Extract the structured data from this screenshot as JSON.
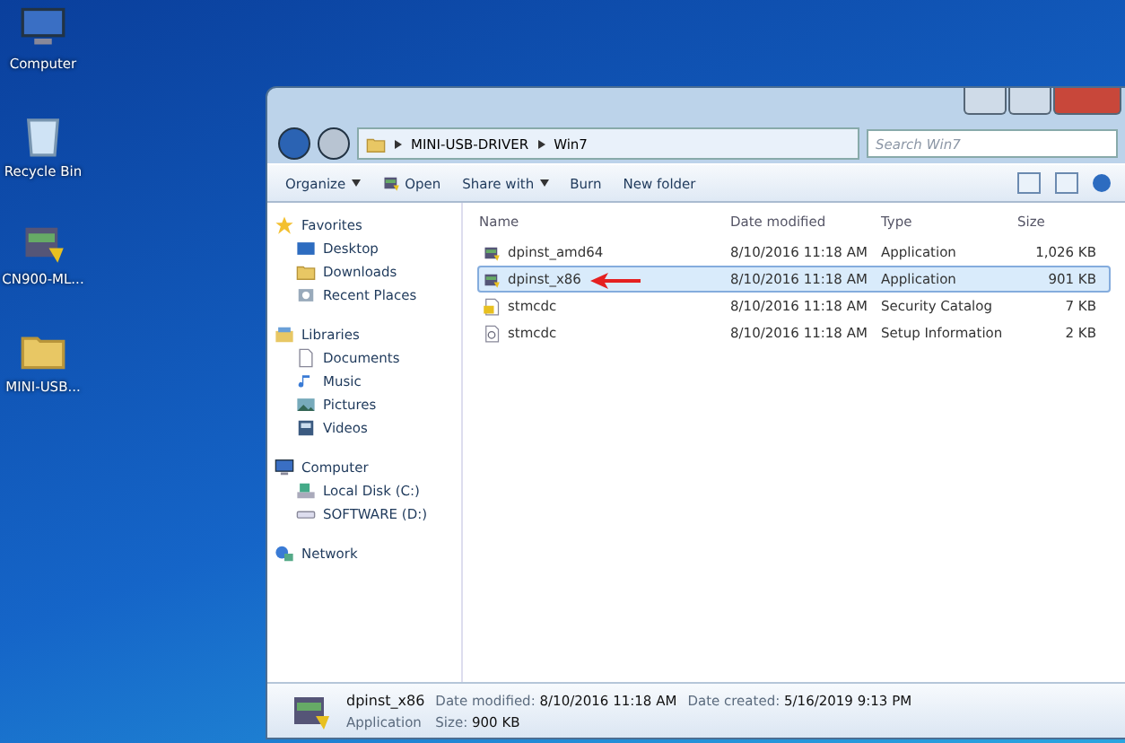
{
  "desktop_icons": [
    {
      "label": "Computer",
      "kind": "computer"
    },
    {
      "label": "Recycle Bin",
      "kind": "recycle"
    },
    {
      "label": "CN900-ML...",
      "kind": "app"
    },
    {
      "label": "MINI-USB...",
      "kind": "folder"
    }
  ],
  "window": {
    "breadcrumb": [
      "MINI-USB-DRIVER",
      "Win7"
    ],
    "search": {
      "placeholder": "Search Win7"
    },
    "toolbar": [
      {
        "label": "Organize",
        "dropdown": true,
        "kind": "plain"
      },
      {
        "label": "Open",
        "dropdown": false,
        "kind": "app"
      },
      {
        "label": "Share with",
        "dropdown": true,
        "kind": "plain"
      },
      {
        "label": "Burn",
        "dropdown": false,
        "kind": "plain"
      },
      {
        "label": "New folder",
        "dropdown": false,
        "kind": "plain"
      }
    ],
    "sidebar": [
      {
        "label": "Favorites",
        "kind": "star",
        "children": [
          {
            "label": "Desktop",
            "kind": "desktop"
          },
          {
            "label": "Downloads",
            "kind": "folder"
          },
          {
            "label": "Recent Places",
            "kind": "recent"
          }
        ]
      },
      {
        "label": "Libraries",
        "kind": "library",
        "children": [
          {
            "label": "Documents",
            "kind": "doc"
          },
          {
            "label": "Music",
            "kind": "music"
          },
          {
            "label": "Pictures",
            "kind": "picture"
          },
          {
            "label": "Videos",
            "kind": "video"
          }
        ]
      },
      {
        "label": "Computer",
        "kind": "computer",
        "children": [
          {
            "label": "Local Disk (C:)",
            "kind": "disk"
          },
          {
            "label": "SOFTWARE (D:)",
            "kind": "drive"
          }
        ]
      },
      {
        "label": "Network",
        "kind": "network"
      }
    ],
    "columns": [
      "Name",
      "Date modified",
      "Type",
      "Size"
    ],
    "rows": [
      {
        "name": "dpinst_amd64",
        "date": "8/10/2016 11:18 AM",
        "type": "Application",
        "size": "1,026 KB",
        "kind": "app",
        "selected": false
      },
      {
        "name": "dpinst_x86",
        "date": "8/10/2016 11:18 AM",
        "type": "Application",
        "size": "901 KB",
        "kind": "app",
        "selected": true
      },
      {
        "name": "stmcdc",
        "date": "8/10/2016 11:18 AM",
        "type": "Security Catalog",
        "size": "7 KB",
        "kind": "catalog",
        "selected": false
      },
      {
        "name": "stmcdc",
        "date": "8/10/2016 11:18 AM",
        "type": "Setup Information",
        "size": "2 KB",
        "kind": "inf",
        "selected": false
      }
    ],
    "details": {
      "name": "dpinst_x86",
      "type": "Application",
      "fields": [
        {
          "label": "Date modified:",
          "value": "8/10/2016 11:18 AM"
        },
        {
          "label": "Date created:",
          "value": "5/16/2019 9:13 PM"
        },
        {
          "label": "Size:",
          "value": "900 KB"
        }
      ]
    }
  }
}
